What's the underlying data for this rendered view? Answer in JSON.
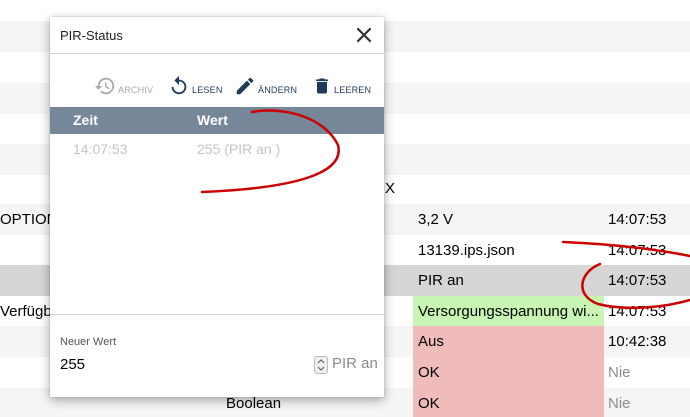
{
  "background_table": {
    "header_fragment": "X",
    "rows": [
      {
        "col_left": "OPTION",
        "col_value": "3,2 V",
        "col_time": "14:07:53"
      },
      {
        "col_left": "",
        "col_value": "13139.ips.json",
        "col_time": "14:07:53"
      },
      {
        "col_left": "",
        "col_value": "PIR an",
        "col_time": "14:07:53"
      },
      {
        "col_left": "Verfügba",
        "col_value": "Versorgungsspannung wi...",
        "col_time": "14:07:53"
      },
      {
        "col_left": "",
        "col_value": "Aus",
        "col_time": "10:42:38"
      },
      {
        "col_left": "",
        "col_value": "OK",
        "col_time": "Nie"
      },
      {
        "col_left": "",
        "col_type": "Boolean",
        "col_value": "OK",
        "col_time": "Nie"
      }
    ]
  },
  "dialog": {
    "title": "PIR-Status",
    "toolbar": {
      "archive": "ARCHIV",
      "read": "LESEN",
      "edit": "ÄNDERN",
      "clear": "LEEREN"
    },
    "columns": {
      "time": "Zeit",
      "value": "Wert"
    },
    "entries": [
      {
        "time": "14:07:53",
        "value": "255 (PIR an )"
      }
    ],
    "new_value": {
      "label": "Neuer Wert",
      "value": "255",
      "suffix": "PIR an"
    }
  },
  "colors": {
    "header_bar": "#77879a",
    "status_red": "#efbbbb",
    "status_green": "#c8f5b4",
    "selected_row": "#d6d6d6",
    "annotation": "#cc0000",
    "toolbar_icon": "#1f3a5c"
  },
  "icons": [
    "history-icon",
    "refresh-icon",
    "pencil-icon",
    "trash-icon",
    "close-icon",
    "spinner-icon"
  ]
}
